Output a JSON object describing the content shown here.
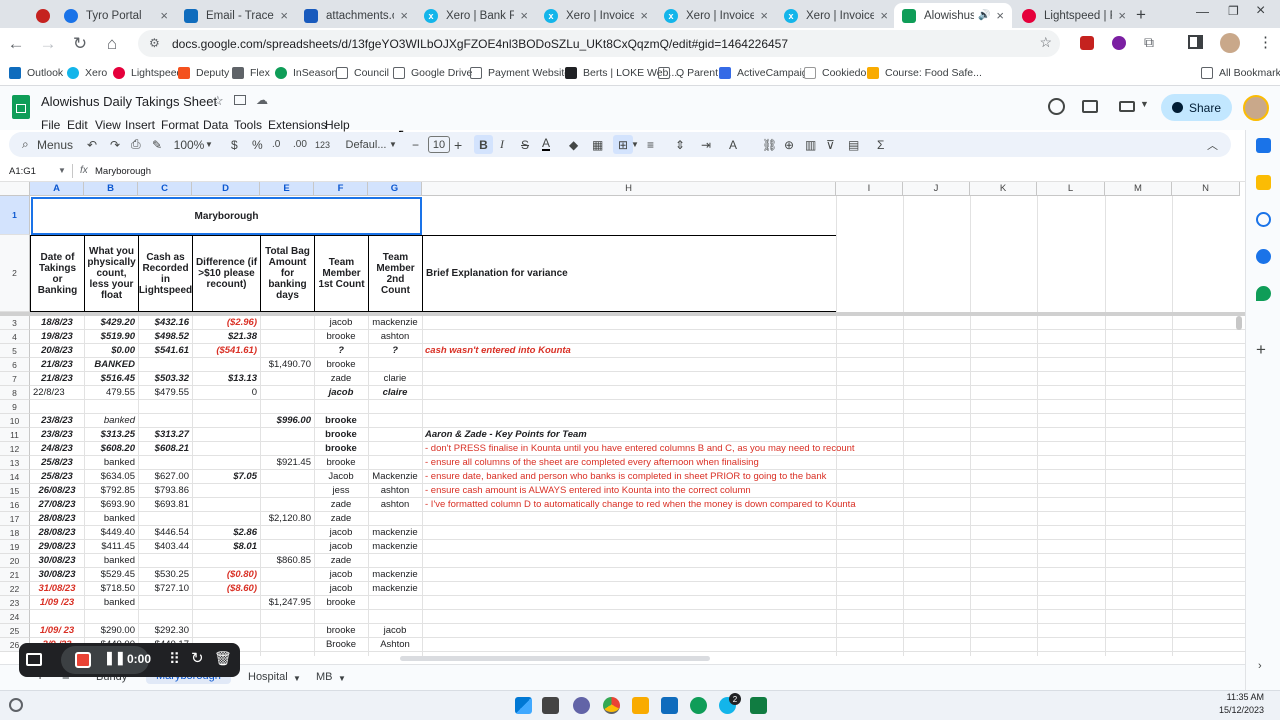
{
  "browser": {
    "tabs": [
      {
        "label": "",
        "color": "#c5221f"
      },
      {
        "label": "Tyro Portal",
        "color": "#1a73e8"
      },
      {
        "label": "Email - Tracey M",
        "color": "#0f6cbd"
      },
      {
        "label": "attachments.offic",
        "color": "#185abd"
      },
      {
        "label": "Xero | Bank Reco",
        "color": "#13b5ea"
      },
      {
        "label": "Xero | Invoices | ",
        "color": "#13b5ea"
      },
      {
        "label": "Xero | Invoice SP",
        "color": "#13b5ea"
      },
      {
        "label": "Xero | Invoice SP",
        "color": "#13b5ea"
      },
      {
        "label": "Alowishus Da",
        "color": "#0f9d58"
      },
      {
        "label": "Lightspeed | Rep",
        "color": "#e5003b"
      }
    ],
    "url": "docs.google.com/spreadsheets/d/13fgeYO3WILbOJXgFZOE4nl3BODoSZLu_UKt8CxQqzmQ/edit#gid=1464226457",
    "bookmarks": [
      "Outlook",
      "Xero",
      "Lightspeed",
      "Deputy",
      "Flex",
      "InSeason",
      "Council",
      "Google Drive",
      "Payment Websites",
      "Berts | LOKE Web...",
      "Q Parent",
      "ActiveCampaign",
      "Cookiedo",
      "Course: Food Safe..."
    ],
    "all_bookmarks": "All Bookmarks"
  },
  "doc": {
    "title": "Alowishus Daily Takings Sheet",
    "menus": [
      "File",
      "Edit",
      "View",
      "Insert",
      "Format",
      "Data",
      "Tools",
      "Extensions",
      "Help"
    ],
    "share_label": "Share"
  },
  "toolbar": {
    "search": "Menus",
    "zoom": "100%",
    "currency": "$",
    "percent": "%",
    "dec_less": ".0",
    "dec_more": ".00",
    "num_format": "123",
    "font": "Defaul...",
    "font_size": "10"
  },
  "formula": {
    "name_box": "A1:G1",
    "fx": "fx",
    "content": "Maryborough"
  },
  "columns": [
    "A",
    "B",
    "C",
    "D",
    "E",
    "F",
    "G",
    "H",
    "I",
    "J",
    "K",
    "L",
    "M",
    "N"
  ],
  "sheet": {
    "title": "Maryborough",
    "headers": [
      "Date of Takings or Banking",
      "What you physically count, less your float",
      "Cash as Recorded in Lightspeed",
      "Difference (if >$10 please recount)",
      "Total Bag Amount for banking days",
      "Team Member 1st Count",
      "Team Member 2nd Count",
      "Brief Explanation for variance"
    ],
    "rows": [
      {
        "n": "3",
        "a": "18/8/23",
        "b": "$429.20",
        "c": "$432.16",
        "d": "($2.96)",
        "e": "",
        "f": "jacob",
        "g": "mackenzie",
        "h": ""
      },
      {
        "n": "4",
        "a": "19/8/23",
        "b": "$519.90",
        "c": "$498.52",
        "d": "$21.38",
        "e": "",
        "f": "brooke",
        "g": "ashton",
        "h": ""
      },
      {
        "n": "5",
        "a": "20/8/23",
        "b": "$0.00",
        "c": "$541.61",
        "d": "($541.61)",
        "e": "",
        "f": "?",
        "g": "?",
        "h": "cash wasn't entered into Kounta"
      },
      {
        "n": "6",
        "a": "21/8/23",
        "b": "BANKED",
        "c": "",
        "d": "",
        "e": "$1,490.70",
        "f": "brooke",
        "g": "",
        "h": ""
      },
      {
        "n": "7",
        "a": "21/8/23",
        "b": "$516.45",
        "c": "$503.32",
        "d": "$13.13",
        "e": "",
        "f": "zade",
        "g": "clarie",
        "h": ""
      },
      {
        "n": "8",
        "a": "22/8/23",
        "b": "479.55",
        "c": "$479.55",
        "d": "0",
        "e": "",
        "f": "jacob",
        "g": "claire",
        "h": ""
      },
      {
        "n": "9",
        "a": "",
        "b": "",
        "c": "",
        "d": "",
        "e": "",
        "f": "",
        "g": "",
        "h": ""
      },
      {
        "n": "10",
        "a": "23/8/23",
        "b": "banked",
        "c": "",
        "d": "",
        "e": "$996.00",
        "f": "brooke",
        "g": "",
        "h": ""
      },
      {
        "n": "11",
        "a": "23/8/23",
        "b": "$313.25",
        "c": "$313.27",
        "d": "",
        "e": "",
        "f": "brooke",
        "g": "",
        "h": "Aaron & Zade - Key Points for Team"
      },
      {
        "n": "12",
        "a": "24/8/23",
        "b": "$608.20",
        "c": "$608.21",
        "d": "",
        "e": "",
        "f": "brooke",
        "g": "",
        "h": "- don't PRESS finalise in Kounta until you have entered columns B and C, as you may need to recount"
      },
      {
        "n": "13",
        "a": "25/8/23",
        "b": "banked",
        "c": "",
        "d": "",
        "e": "$921.45",
        "f": "brooke",
        "g": "",
        "h": "- ensure all columns of the sheet are completed every afternoon when finalising"
      },
      {
        "n": "14",
        "a": "25/8/23",
        "b": "$634.05",
        "c": "$627.00",
        "d": "$7.05",
        "e": "",
        "f": "Jacob",
        "g": "Mackenzie",
        "h": "- ensure date, banked and person who banks is completed in sheet PRIOR to going to the bank"
      },
      {
        "n": "15",
        "a": "26/08/23",
        "b": "$792.85",
        "c": "$793.86",
        "d": "",
        "e": "",
        "f": "jess",
        "g": "ashton",
        "h": "- ensure cash amount is ALWAYS entered into Kounta into the correct column"
      },
      {
        "n": "16",
        "a": "27/08/23",
        "b": "$693.90",
        "c": "$693.81",
        "d": "",
        "e": "",
        "f": "zade",
        "g": "ashton",
        "h": "- I've formatted column D to automatically change to red when the money is down compared to Kounta"
      },
      {
        "n": "17",
        "a": "28/08/23",
        "b": "banked",
        "c": "",
        "d": "",
        "e": "$2,120.80",
        "f": "zade",
        "g": "",
        "h": ""
      },
      {
        "n": "18",
        "a": "28/08/23",
        "b": "$449.40",
        "c": "$446.54",
        "d": "$2.86",
        "e": "",
        "f": "jacob",
        "g": "mackenzie",
        "h": ""
      },
      {
        "n": "19",
        "a": "29/08/23",
        "b": "$411.45",
        "c": "$403.44",
        "d": "$8.01",
        "e": "",
        "f": "jacob",
        "g": "mackenzie",
        "h": ""
      },
      {
        "n": "20",
        "a": "30/08/23",
        "b": "banked",
        "c": "",
        "d": "",
        "e": "$860.85",
        "f": "zade",
        "g": "",
        "h": ""
      },
      {
        "n": "21",
        "a": "30/08/23",
        "b": "$529.45",
        "c": "$530.25",
        "d": "($0.80)",
        "e": "",
        "f": "jacob",
        "g": "mackenzie",
        "h": ""
      },
      {
        "n": "22",
        "a": "31/08/23",
        "b": "$718.50",
        "c": "$727.10",
        "d": "($8.60)",
        "e": "",
        "f": "jacob",
        "g": "mackenzie",
        "h": ""
      },
      {
        "n": "23",
        "a": "1/09 /23",
        "b": "banked",
        "c": "",
        "d": "",
        "e": "$1,247.95",
        "f": "brooke",
        "g": "",
        "h": ""
      },
      {
        "n": "24",
        "a": "",
        "b": "",
        "c": "",
        "d": "",
        "e": "",
        "f": "",
        "g": "",
        "h": ""
      },
      {
        "n": "25",
        "a": "1/09/ 23",
        "b": "$290.00",
        "c": "$292.30",
        "d": "",
        "e": "",
        "f": "brooke",
        "g": "jacob",
        "h": ""
      },
      {
        "n": "26",
        "a": "2/9 /23",
        "b": "$440.00",
        "c": "$440.17",
        "d": "",
        "e": "",
        "f": "Brooke",
        "g": "Ashton",
        "h": ""
      }
    ],
    "red_text_color": "#d93025",
    "selection_color": "#1a73e8"
  },
  "sheet_tabs": [
    "Bundy",
    "Maryborough",
    "Hospital",
    "MB"
  ],
  "recorder": {
    "time": "0:00"
  },
  "taskbar": {
    "time": "11:35 AM",
    "date": "15/12/2023",
    "badge": "2"
  }
}
